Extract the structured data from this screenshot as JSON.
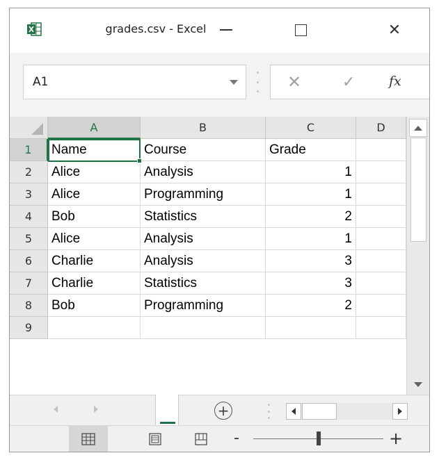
{
  "window": {
    "title": "grades.csv - Excel",
    "close_glyph": "✕",
    "accent_color": "#217346"
  },
  "formula_bar": {
    "name_box": "A1",
    "cancel_glyph": "✕",
    "enter_glyph": "✓",
    "fx_label": "fx"
  },
  "grid": {
    "columns": [
      "A",
      "B",
      "C",
      "D"
    ],
    "rows": [
      "1",
      "2",
      "3",
      "4",
      "5",
      "6",
      "7",
      "8",
      "9"
    ],
    "cells": [
      [
        "Name",
        "Course",
        "Grade"
      ],
      [
        "Alice",
        "Analysis",
        "1"
      ],
      [
        "Alice",
        "Programming",
        "1"
      ],
      [
        "Bob",
        "Statistics",
        "2"
      ],
      [
        "Alice",
        "Analysis",
        "1"
      ],
      [
        "Charlie",
        "Analysis",
        "3"
      ],
      [
        "Charlie",
        "Statistics",
        "3"
      ],
      [
        "Bob",
        "Programming",
        "2"
      ],
      [
        "",
        "",
        ""
      ]
    ],
    "active_cell": "A1"
  },
  "sheet_bar": {
    "add_sheet_glyph": "+"
  },
  "status_bar": {
    "zoom_minus": "-",
    "zoom_plus": "+",
    "zoom_fraction": 0.5
  }
}
